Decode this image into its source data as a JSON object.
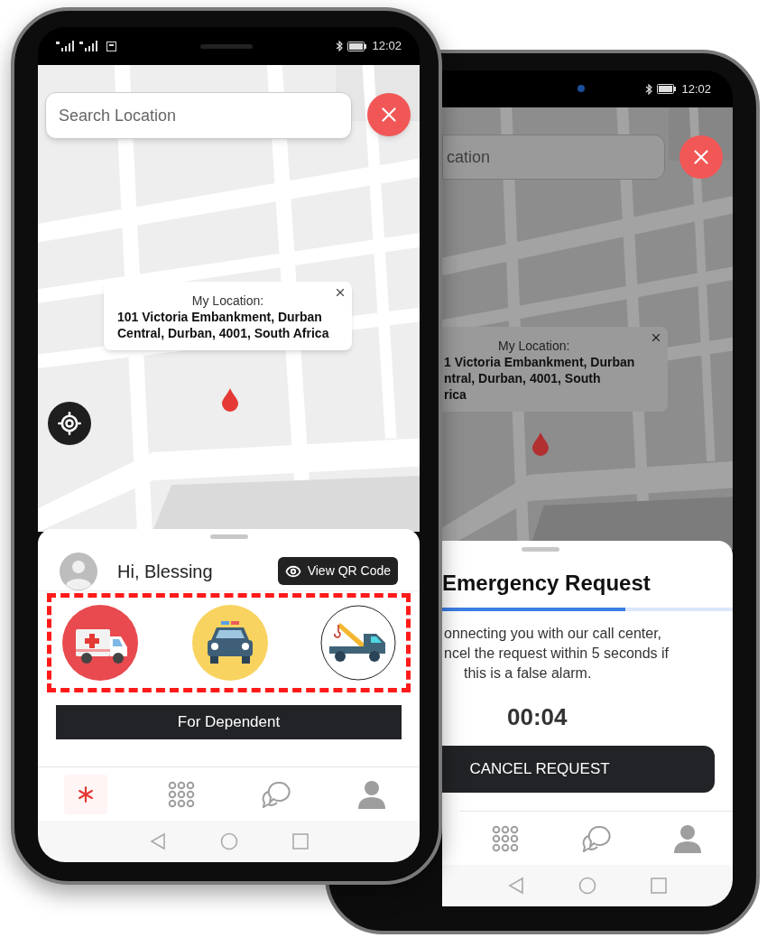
{
  "home_screen": {
    "status_bar": {
      "time": "12:02"
    },
    "search": {
      "placeholder": "Search Location"
    },
    "popup": {
      "title": "My Location:",
      "address": "101 Victoria Embankment, Durban Central, Durban, 4001, South Africa"
    },
    "greeting": "Hi, Blessing",
    "qr_button": "View QR Code",
    "services": [
      {
        "kind": "ambulance"
      },
      {
        "kind": "police"
      },
      {
        "kind": "tow_truck"
      }
    ],
    "dependent_button": "For Dependent",
    "nav": [
      {
        "kind": "emergency",
        "selected": true
      },
      {
        "kind": "apps",
        "selected": false
      },
      {
        "kind": "chat",
        "selected": false
      },
      {
        "kind": "profile",
        "selected": false
      }
    ]
  },
  "request_screen": {
    "status_bar": {
      "time": "12:02"
    },
    "search": {
      "placeholder": "cation"
    },
    "popup": {
      "title": "My Location:",
      "address_lines": [
        "1 Victoria Embankment, Durban",
        "ntral, Durban, 4001, South",
        "rica"
      ]
    },
    "sheet": {
      "title": "Emergency Request",
      "progress": {
        "level": 0.63
      },
      "message_lines": [
        "onnecting you with our call center,",
        "ncel the request within 5 seconds if",
        "this is a false alarm."
      ],
      "countdown": "00:04",
      "cancel_button": "CANCEL REQUEST"
    },
    "nav": [
      {
        "kind": "apps",
        "selected": false
      },
      {
        "kind": "chat",
        "selected": false
      },
      {
        "kind": "profile",
        "selected": false
      }
    ]
  }
}
